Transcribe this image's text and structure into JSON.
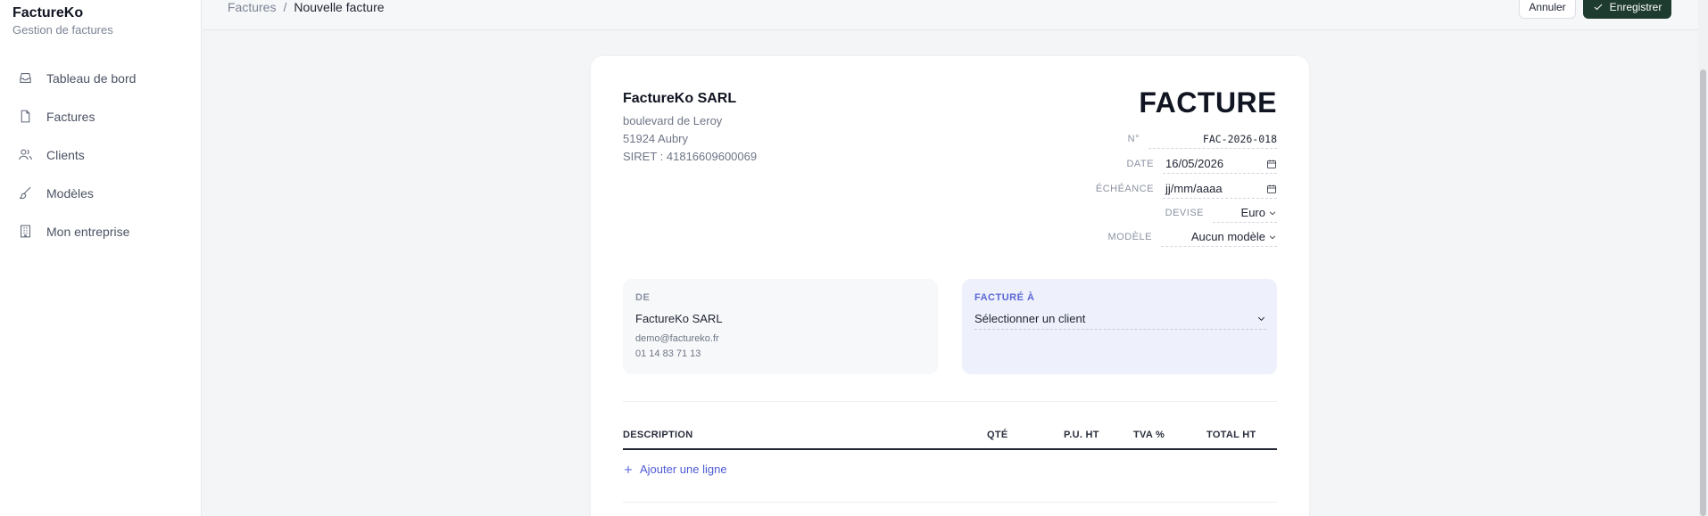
{
  "brand": {
    "name": "FactureKo",
    "subtitle": "Gestion de factures"
  },
  "sidebar": {
    "items": [
      {
        "label": "Tableau de bord",
        "icon": "inbox-icon"
      },
      {
        "label": "Factures",
        "icon": "file-icon"
      },
      {
        "label": "Clients",
        "icon": "users-icon"
      },
      {
        "label": "Modèles",
        "icon": "brush-icon"
      },
      {
        "label": "Mon entreprise",
        "icon": "building-icon"
      }
    ]
  },
  "header": {
    "breadcrumb": {
      "parent": "Factures",
      "separator": "/",
      "current": "Nouvelle facture"
    },
    "cancel_label": "Annuler",
    "save_label": "Enregistrer"
  },
  "invoice": {
    "company": {
      "name": "FactureKo SARL",
      "street": "boulevard de Leroy",
      "city": "51924 Aubry",
      "siret": "SIRET : 41816609600069"
    },
    "title": "FACTURE",
    "meta": {
      "number_label": "N°",
      "number_value": "FAC-2026-018",
      "date_label": "DATE",
      "date_value": "16/05/2026",
      "due_label": "ÉCHÉANCE",
      "due_placeholder": "jj/mm/aaaa",
      "currency_label": "DEVISE",
      "currency_value": "Euro",
      "template_label": "MODÈLE",
      "template_value": "Aucun modèle"
    },
    "from": {
      "label": "DE",
      "name": "FactureKo SARL",
      "email": "demo@factureko.fr",
      "phone": "01 14 83 71 13"
    },
    "to": {
      "label": "FACTURÉ À",
      "select_placeholder": "Sélectionner un client"
    },
    "table": {
      "headers": {
        "description": "DESCRIPTION",
        "qty": "QTÉ",
        "unit_price": "P.U. HT",
        "vat": "TVA %",
        "total": "TOTAL HT"
      },
      "add_line_label": "Ajouter une ligne"
    }
  },
  "colors": {
    "accent": "#1e3b2f",
    "link": "#4f5bd5",
    "billed_to_bg": "#eef1fb"
  }
}
